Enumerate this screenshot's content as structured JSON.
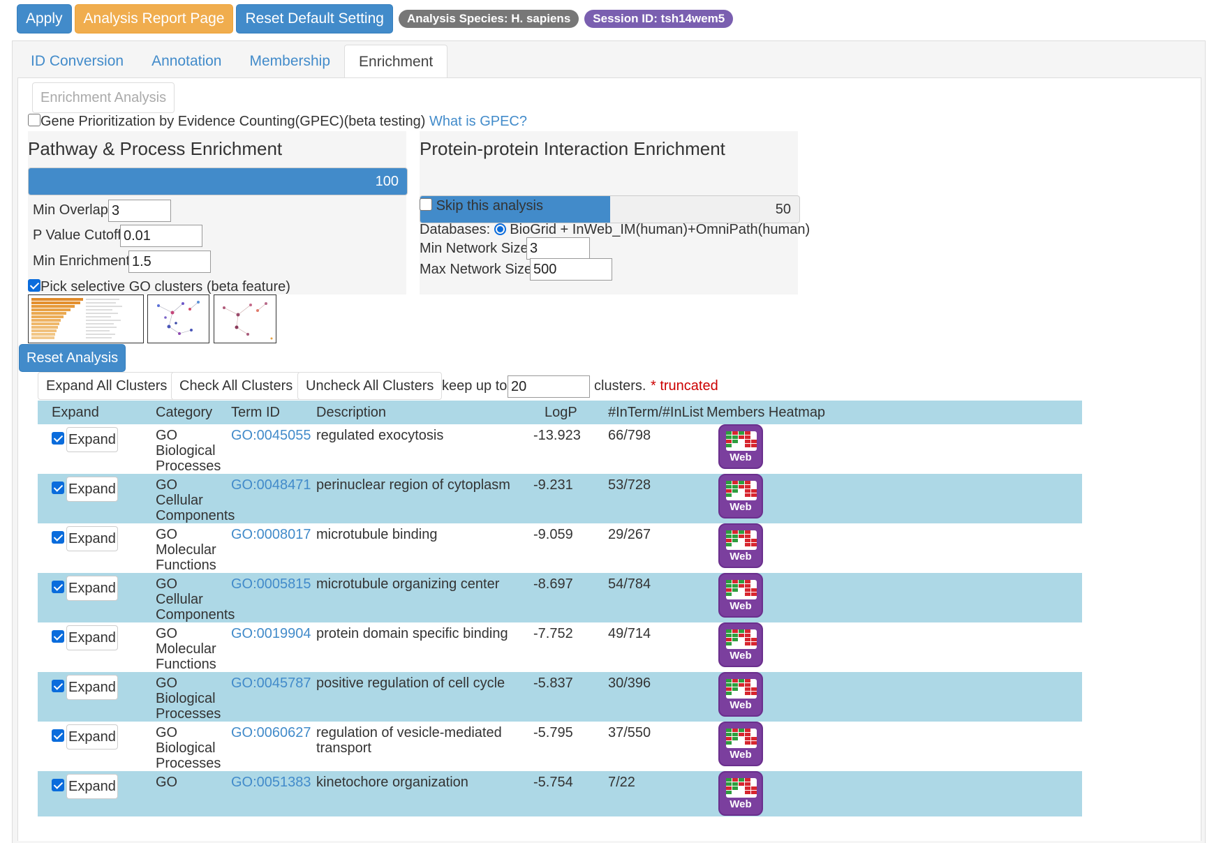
{
  "toolbar": {
    "apply": "Apply",
    "report": "Analysis Report Page",
    "reset_default": "Reset Default Setting",
    "species": "Analysis Species: H. sapiens",
    "session": "Session ID: tsh14wem5"
  },
  "tabs": [
    "ID Conversion",
    "Annotation",
    "Membership",
    "Enrichment"
  ],
  "active_tab": "Enrichment",
  "enrichment": {
    "enrichment_analysis_button": "Enrichment Analysis",
    "gpec_label": "Gene Prioritization by Evidence Counting(GPEC)(beta testing)",
    "gpec_link": "What is GPEC?",
    "gpec_checked": false,
    "pathway": {
      "title": "Pathway & Process Enrichment",
      "slider_value": "100",
      "slider_fraction": 1.0,
      "min_overlap_label": "Min Overlap:",
      "min_overlap": "3",
      "pvalue_label": "P Value Cutoff:",
      "pvalue": "0.01",
      "min_enrichment_label": "Min Enrichment:",
      "min_enrichment": "1.5",
      "pick_go_label": "Pick selective GO clusters (beta feature)",
      "pick_go_checked": true
    },
    "ppi": {
      "title": "Protein-protein Interaction Enrichment",
      "slider_value": "50",
      "slider_fraction": 0.5,
      "skip_label": "Skip this analysis",
      "skip_checked": false,
      "databases_label": "Databases:",
      "database_option": "BioGrid + InWeb_IM(human)+OmniPath(human)",
      "min_network_label": "Min Network Size:",
      "min_network": "3",
      "max_network_label": "Max Network Size:",
      "max_network": "500"
    },
    "reset_analysis": "Reset Analysis"
  },
  "clusters": {
    "expand_all": "Expand All Clusters",
    "check_all": "Check All Clusters",
    "uncheck_all": "Uncheck All Clusters",
    "keep_up_to": "keep up to",
    "keep_value": "20",
    "clusters_word": "clusters.",
    "truncated": "* truncated"
  },
  "table": {
    "headers": [
      "Expand",
      "Category",
      "Term ID",
      "Description",
      "LogP",
      "#InTerm/#InList",
      "Members Heatmap"
    ],
    "expand_label": "Expand",
    "web_label": "Web",
    "rows": [
      {
        "category": [
          "GO",
          "Biological",
          "Processes"
        ],
        "term": "GO:0045055",
        "desc": [
          "regulated exocytosis"
        ],
        "logp": "-13.923",
        "ratio": "66/798"
      },
      {
        "category": [
          "GO",
          "Cellular",
          "Components"
        ],
        "term": "GO:0048471",
        "desc": [
          "perinuclear region of cytoplasm"
        ],
        "logp": "-9.231",
        "ratio": "53/728"
      },
      {
        "category": [
          "GO",
          "Molecular",
          "Functions"
        ],
        "term": "GO:0008017",
        "desc": [
          "microtubule binding"
        ],
        "logp": "-9.059",
        "ratio": "29/267"
      },
      {
        "category": [
          "GO",
          "Cellular",
          "Components"
        ],
        "term": "GO:0005815",
        "desc": [
          "microtubule organizing center"
        ],
        "logp": "-8.697",
        "ratio": "54/784"
      },
      {
        "category": [
          "GO",
          "Molecular",
          "Functions"
        ],
        "term": "GO:0019904",
        "desc": [
          "protein domain specific binding"
        ],
        "logp": "-7.752",
        "ratio": "49/714"
      },
      {
        "category": [
          "GO",
          "Biological",
          "Processes"
        ],
        "term": "GO:0045787",
        "desc": [
          "positive regulation of cell cycle"
        ],
        "logp": "-5.837",
        "ratio": "30/396"
      },
      {
        "category": [
          "GO",
          "Biological",
          "Processes"
        ],
        "term": "GO:0060627",
        "desc": [
          "regulation of vesicle-mediated",
          "transport"
        ],
        "logp": "-5.795",
        "ratio": "37/550"
      },
      {
        "category": [
          "GO"
        ],
        "term": "GO:0051383",
        "desc": [
          "kinetochore organization"
        ],
        "logp": "-5.754",
        "ratio": "7/22"
      }
    ]
  }
}
